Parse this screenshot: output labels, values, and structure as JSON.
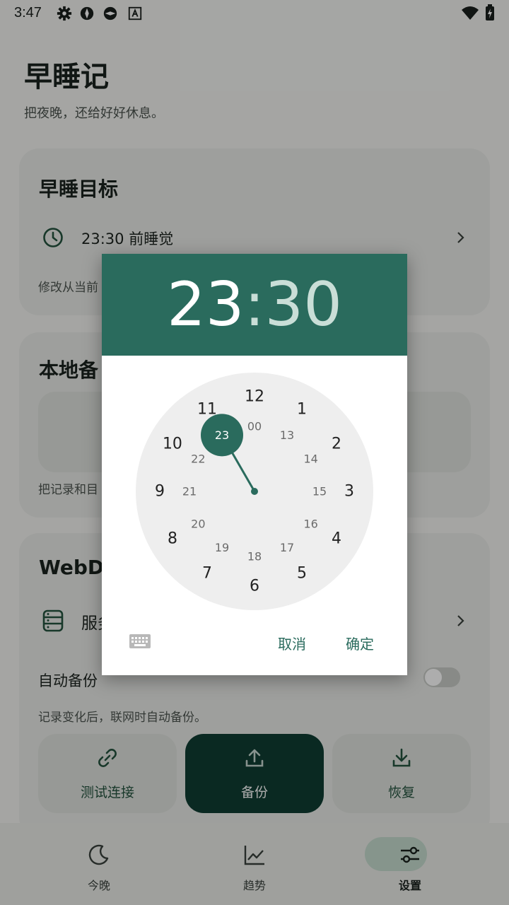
{
  "status_bar": {
    "time": "3:47",
    "icons": [
      "gear-icon",
      "aperture-icon",
      "aperture-icon",
      "font-icon"
    ],
    "right_icons": [
      "wifi-icon",
      "battery-charging-icon"
    ]
  },
  "header": {
    "title": "早睡记",
    "subtitle": "把夜晚，还给好好休息。"
  },
  "goal_card": {
    "title": "早睡目标",
    "time_row": "23:30 前睡觉",
    "hint": "修改从当前"
  },
  "backup_card": {
    "title": "本地备",
    "hint": "把记录和目"
  },
  "webdav_card": {
    "title": "WebDA",
    "server_row": "服务",
    "auto_backup_label": "自动备份",
    "auto_backup_hint": "记录变化后，联网时自动备份。",
    "buttons": {
      "test": "测试连接",
      "backup": "备份",
      "restore": "恢复"
    }
  },
  "nav": {
    "tonight": "今晚",
    "trend": "趋势",
    "settings": "设置"
  },
  "dialog": {
    "hour": "23",
    "colon": ":",
    "minute": "30",
    "selected_hour": 23,
    "outer_ring": [
      "12",
      "1",
      "2",
      "3",
      "4",
      "5",
      "6",
      "7",
      "8",
      "9",
      "10",
      "11"
    ],
    "inner_ring": [
      "00",
      "13",
      "14",
      "15",
      "16",
      "17",
      "18",
      "19",
      "20",
      "21",
      "22",
      "23"
    ],
    "cancel": "取消",
    "ok": "确定"
  },
  "colors": {
    "accent": "#2a6b5d",
    "primary_dark": "#0f3d33",
    "dial_face": "#eeeeee"
  }
}
